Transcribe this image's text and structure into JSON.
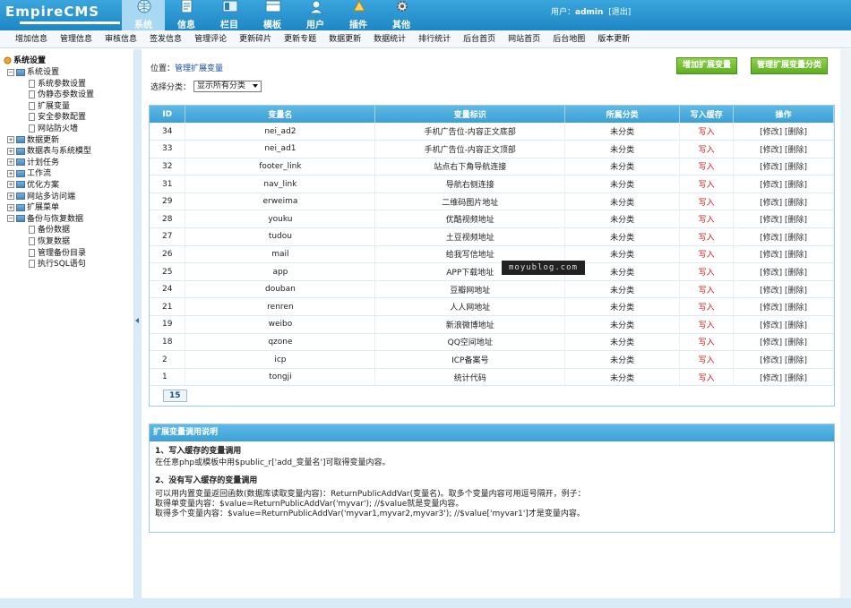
{
  "header": {
    "logo": "EmpireCMS",
    "nav": [
      {
        "label": "系统",
        "icon": "globe-icon",
        "active": true
      },
      {
        "label": "信息",
        "icon": "document-icon"
      },
      {
        "label": "栏目",
        "icon": "column-icon"
      },
      {
        "label": "模板",
        "icon": "template-icon"
      },
      {
        "label": "用户",
        "icon": "user-icon"
      },
      {
        "label": "插件",
        "icon": "plugin-icon"
      },
      {
        "label": "其他",
        "icon": "gear-icon"
      }
    ],
    "user_prefix": "用户：",
    "username": "admin",
    "logout": "[退出]"
  },
  "subbar": [
    "增加信息",
    "管理信息",
    "审核信息",
    "签发信息",
    "管理评论",
    "更新碎片",
    "更新专题",
    "数据更新",
    "数据统计",
    "排行统计",
    "后台首页",
    "网站首页",
    "后台地图",
    "版本更新"
  ],
  "tree": {
    "root": "系统设置",
    "items": [
      {
        "label": "系统设置",
        "level": 1,
        "expanded": true,
        "children": [
          "系统参数设置",
          "伪静态参数设置",
          "扩展变量",
          "安全参数配置",
          "网站防火墙"
        ]
      },
      {
        "label": "数据更新",
        "level": 1
      },
      {
        "label": "数据表与系统模型",
        "level": 1
      },
      {
        "label": "计划任务",
        "level": 1
      },
      {
        "label": "工作流",
        "level": 1
      },
      {
        "label": "优化方案",
        "level": 1
      },
      {
        "label": "网站多访问端",
        "level": 1
      },
      {
        "label": "扩展菜单",
        "level": 1
      },
      {
        "label": "备份与恢复数据",
        "level": 1,
        "expanded": true,
        "children": [
          "备份数据",
          "恢复数据",
          "管理备份目录",
          "执行SQL语句"
        ]
      }
    ]
  },
  "main": {
    "location_label": "位置：",
    "location_link": "管理扩展变量",
    "btn_add": "增加扩展变量",
    "btn_manage": "管理扩展变量分类",
    "filter_label": "选择分类：",
    "filter_value": "显示所有分类",
    "table": {
      "headers": [
        "ID",
        "变量名",
        "变量标识",
        "所属分类",
        "写入缓存",
        "操作"
      ],
      "rows": [
        [
          "34",
          "nei_ad2",
          "手机广告位-内容正文底部",
          "未分类",
          "写入",
          "[修改] [删除]"
        ],
        [
          "33",
          "nei_ad1",
          "手机广告位-内容正文顶部",
          "未分类",
          "写入",
          "[修改] [删除]"
        ],
        [
          "32",
          "footer_link",
          "站点右下角导航连接",
          "未分类",
          "写入",
          "[修改] [删除]"
        ],
        [
          "31",
          "nav_link",
          "导航右侧连接",
          "未分类",
          "写入",
          "[修改] [删除]"
        ],
        [
          "29",
          "erweima",
          "二维码图片地址",
          "未分类",
          "写入",
          "[修改] [删除]"
        ],
        [
          "28",
          "youku",
          "优酷视频地址",
          "未分类",
          "写入",
          "[修改] [删除]"
        ],
        [
          "27",
          "tudou",
          "土豆视频地址",
          "未分类",
          "写入",
          "[修改] [删除]"
        ],
        [
          "26",
          "mail",
          "给我写信地址",
          "未分类",
          "写入",
          "[修改] [删除]"
        ],
        [
          "25",
          "app",
          "APP下载地址",
          "未分类",
          "写入",
          "[修改] [删除]"
        ],
        [
          "24",
          "douban",
          "豆瓣网地址",
          "未分类",
          "写入",
          "[修改] [删除]"
        ],
        [
          "21",
          "renren",
          "人人网地址",
          "未分类",
          "写入",
          "[修改] [删除]"
        ],
        [
          "19",
          "weibo",
          "新浪微博地址",
          "未分类",
          "写入",
          "[修改] [删除]"
        ],
        [
          "18",
          "qzone",
          "QQ空间地址",
          "未分类",
          "写入",
          "[修改] [删除]"
        ],
        [
          "2",
          "icp",
          "ICP备案号",
          "未分类",
          "写入",
          "[修改] [删除]"
        ],
        [
          "1",
          "tongji",
          "统计代码",
          "未分类",
          "写入",
          "[修改] [删除]"
        ]
      ],
      "page": "15"
    },
    "help": {
      "title": "扩展变量调用说明",
      "h1": "1、写入缓存的变量调用",
      "p1": "在任意php或模板中用$public_r['add_变量名']可取得变量内容。",
      "h2": "2、没有写入缓存的变量调用",
      "p2": "可以用内置变量返回函数(数据库读取变量内容)：ReturnPublicAddVar(变量名)。取多个变量内容可用逗号隔开，例子：",
      "p3": "取得单变量内容：$value=ReturnPublicAddVar('myvar'); //$value就是变量内容。",
      "p4": "取得多个变量内容：$value=ReturnPublicAddVar('myvar1,myvar2,myvar3'); //$value['myvar1']才是变量内容。"
    },
    "watermark": "moyublog.com"
  }
}
